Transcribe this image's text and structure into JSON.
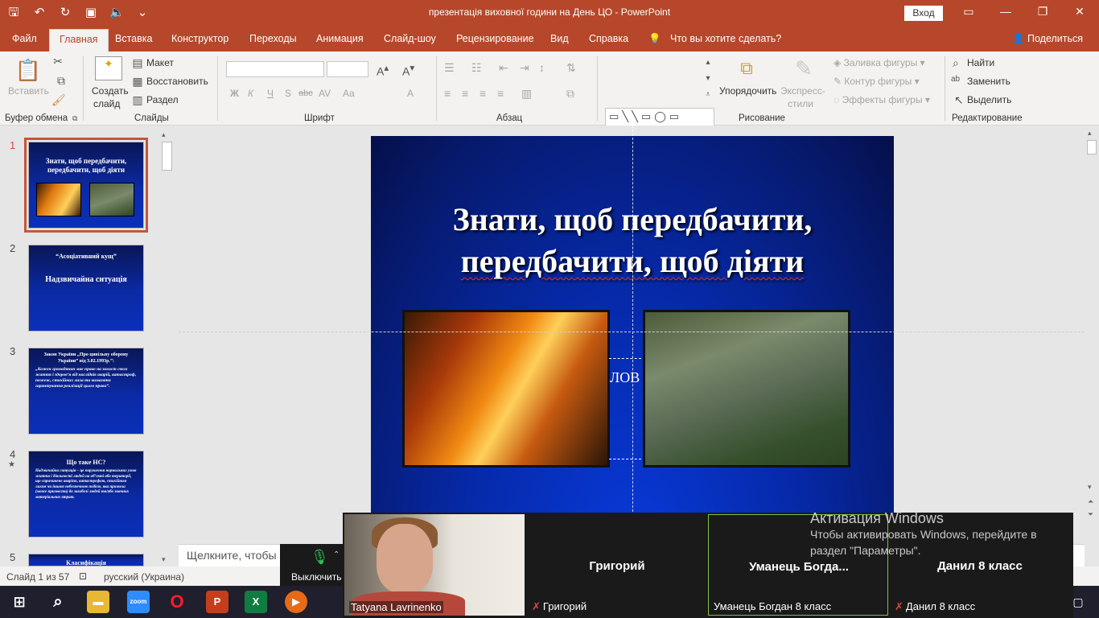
{
  "window": {
    "title": "презентація виховної години на День ЦО  -  PowerPoint",
    "signin": "Вход"
  },
  "tabs": [
    "Файл",
    "Главная",
    "Вставка",
    "Конструктор",
    "Переходы",
    "Анимация",
    "Слайд-шоу",
    "Рецензирование",
    "Вид",
    "Справка"
  ],
  "tell_me": "Что вы хотите сделать?",
  "share": "Поделиться",
  "ribbon": {
    "clipboard": {
      "paste": "Вставить",
      "label": "Буфер обмена"
    },
    "slides": {
      "new_slide_line1": "Создать",
      "new_slide_line2": "слайд",
      "layout": "Макет",
      "reset": "Восстановить",
      "section": "Раздел",
      "label": "Слайды"
    },
    "font": {
      "label": "Шрифт",
      "bold": "Ж",
      "italic": "К",
      "underline": "Ч",
      "shadow": "S",
      "strike": "abc",
      "spacing": "AV",
      "case": "Aa",
      "color": "A"
    },
    "paragraph": {
      "label": "Абзац"
    },
    "drawing": {
      "arrange": "Упорядочить",
      "quick_styles_line1": "Экспресс-",
      "quick_styles_line2": "стили",
      "fill": "Заливка фигуры",
      "outline": "Контур фигуры",
      "effects": "Эффекты фигуры",
      "label": "Рисование"
    },
    "editing": {
      "find": "Найти",
      "replace": "Заменить",
      "select": "Выделить",
      "label": "Редактирование"
    }
  },
  "thumbnails": [
    {
      "num": "1",
      "title": "Знати, щоб передбачити, передбачити, щоб діяти",
      "body": ""
    },
    {
      "num": "2",
      "title": "“Асоціативний кущ”",
      "body": "Надзвичайна ситуація"
    },
    {
      "num": "3",
      "title": "Закон України „Про цивільну оборону України” від 3.02.1993р.”:",
      "body": "„Кожен громадянин має право на захист свого життя і здоров’я від наслідків аварій, катастроф, пожеж, стихійних лиха та вимагати гарантування реалізації цього права”."
    },
    {
      "num": "4",
      "title": "Що таке НС?",
      "body": "Надзвичайна ситуація – це порушення нормальних умов життя і діяльності людей на об’єкті або території, що спричинене аварією, катастрофою, стихійним лихом чи іншою небезпечною подією, яка призвела (може призвести) до загибелі людей та/або значних матеріальних втрат."
    },
    {
      "num": "5",
      "title": "Класифікація",
      "body": ""
    }
  ],
  "slide": {
    "title_line1": "Знати, щоб передбачити,",
    "title_line2": "передбачити, щоб діяти",
    "hidden_text": "ЛОВ"
  },
  "notes_placeholder": "Щелкните, чтобы",
  "status": {
    "slide_info": "Слайд 1 из 57",
    "language": "русский (Украина)"
  },
  "zoom": {
    "mute_label": "Выключить",
    "participants": [
      {
        "name": "Tatyana Lavrinenko",
        "display": "",
        "muted": false
      },
      {
        "name": "Григорий",
        "display": "Григорий",
        "muted": true
      },
      {
        "name": "Уманець Богдан 8 класс",
        "display": "Уманець  Богда...",
        "muted": false
      },
      {
        "name": "Данил 8 класс",
        "display": "Данил 8 класс",
        "muted": true
      }
    ]
  },
  "watermark": {
    "title": "Активация Windows",
    "line1": "Чтобы активировать Windows, перейдите в",
    "line2": "раздел \"Параметры\"."
  },
  "taskbar": [
    "zoom"
  ],
  "colors": {
    "accent": "#b7472a",
    "slide_bg": "#0629a8"
  }
}
